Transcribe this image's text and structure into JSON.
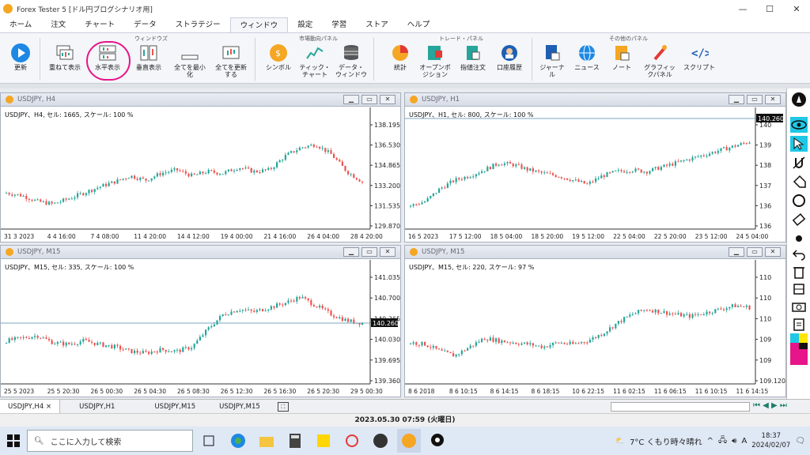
{
  "window": {
    "title": "Forex Tester 5 [ドル円ブログシナリオ用]",
    "minimize": "—",
    "maximize": "☐",
    "close": "✕"
  },
  "menu": [
    "ホーム",
    "注文",
    "チャート",
    "データ",
    "ストラテジー",
    "ウィンドウ",
    "設定",
    "学習",
    "ストア",
    "ヘルプ"
  ],
  "menu_active": "ウィンドウ",
  "ribbon": {
    "groups": {
      "window": "ウィンドウズ",
      "market": "市場動向パネル",
      "trade": "トレード・パネル",
      "other": "その他のパネル"
    },
    "buttons": {
      "update": "更新",
      "cascade": "重ねて表示",
      "horizontal": "水平表示",
      "vertical": "垂直表示",
      "minimize_all": "全てを最小\n化",
      "refresh_all": "全てを更新\nする",
      "symbol": "シンボル",
      "tick_chart": "ティック・\nチャート",
      "data_window": "データ・\nウィンドウ",
      "stats": "統計",
      "open_positions": "オープンポ\nジション",
      "pending_orders": "指値注文",
      "account_history": "口座履歴",
      "journal": "ジャーナ\nル",
      "news": "ニュース",
      "note": "ノート",
      "graphic_panel": "グラフィッ\nクパネル",
      "script": "スクリプト"
    }
  },
  "charts": [
    {
      "id": "c1",
      "title": "USDJPY, H4",
      "info": "USDJPY、H4, セル: 1665, スケール: 100 %",
      "yticks": [
        "138.195",
        "136.530",
        "134.865",
        "133.200",
        "131.535",
        "129.870"
      ],
      "xticks": [
        "31 3 2023",
        "4 4 16:00",
        "7 4 08:00",
        "11 4 20:00",
        "14 4 12:00",
        "19 4 00:00",
        "21 4 16:00",
        "26 4 04:00",
        "28 4 20:00"
      ],
      "price_label": ""
    },
    {
      "id": "c2",
      "title": "USDJPY, H1",
      "info": "USDJPY、H1, セル: 800, スケール: 100 %",
      "yticks": [
        "140",
        "139",
        "138",
        "137",
        "136",
        "136"
      ],
      "xticks": [
        "16 5 2023",
        "17 5 12:00",
        "18 5 04:00",
        "18 5 20:00",
        "19 5 12:00",
        "22 5 04:00",
        "22 5 20:00",
        "23 5 12:00",
        "24 5 04:00"
      ],
      "price_label": "140.260"
    },
    {
      "id": "c3",
      "title": "USDJPY, M15",
      "info": "USDJPY、M15, セル: 335, スケール: 100 %",
      "yticks": [
        "141.035",
        "140.700",
        "140.365",
        "140.030",
        "139.695",
        "139.360"
      ],
      "xticks": [
        "25 5 2023",
        "25 5 20:30",
        "26 5 00:30",
        "26 5 04:30",
        "26 5 08:30",
        "26 5 12:30",
        "26 5 16:30",
        "26 5 20:30",
        "29 5 00:30"
      ],
      "price_label": "140.260"
    },
    {
      "id": "c4",
      "title": "USDJPY, M15",
      "info": "USDJPY、M15, セル: 220, スケール: 97 %",
      "yticks": [
        "110",
        "110",
        "110",
        "109",
        "109",
        "109.120"
      ],
      "xticks": [
        "8 6 2018",
        "8 6 10:15",
        "8 6 14:15",
        "8 6 18:15",
        "10 6 22:15",
        "11 6 02:15",
        "11 6 06:15",
        "11 6 10:15",
        "11 6 14:15"
      ],
      "price_label": ""
    }
  ],
  "chart_tabs": [
    "USDJPY,H4",
    "USDJPY,H1",
    "USDJPY,M15",
    "USDJPY,M15"
  ],
  "chart_tab_close": "×",
  "status": "2023.05.30 07:59 (火曜日)",
  "taskbar": {
    "search_placeholder": "ここに入力して検索",
    "weather": "7°C くもり時々晴れ",
    "ime": "A",
    "time": "18:37",
    "date": "2024/02/07"
  },
  "colors": {
    "bull": "#26a69a",
    "bear": "#ef5350",
    "accent": "#e6158a"
  }
}
